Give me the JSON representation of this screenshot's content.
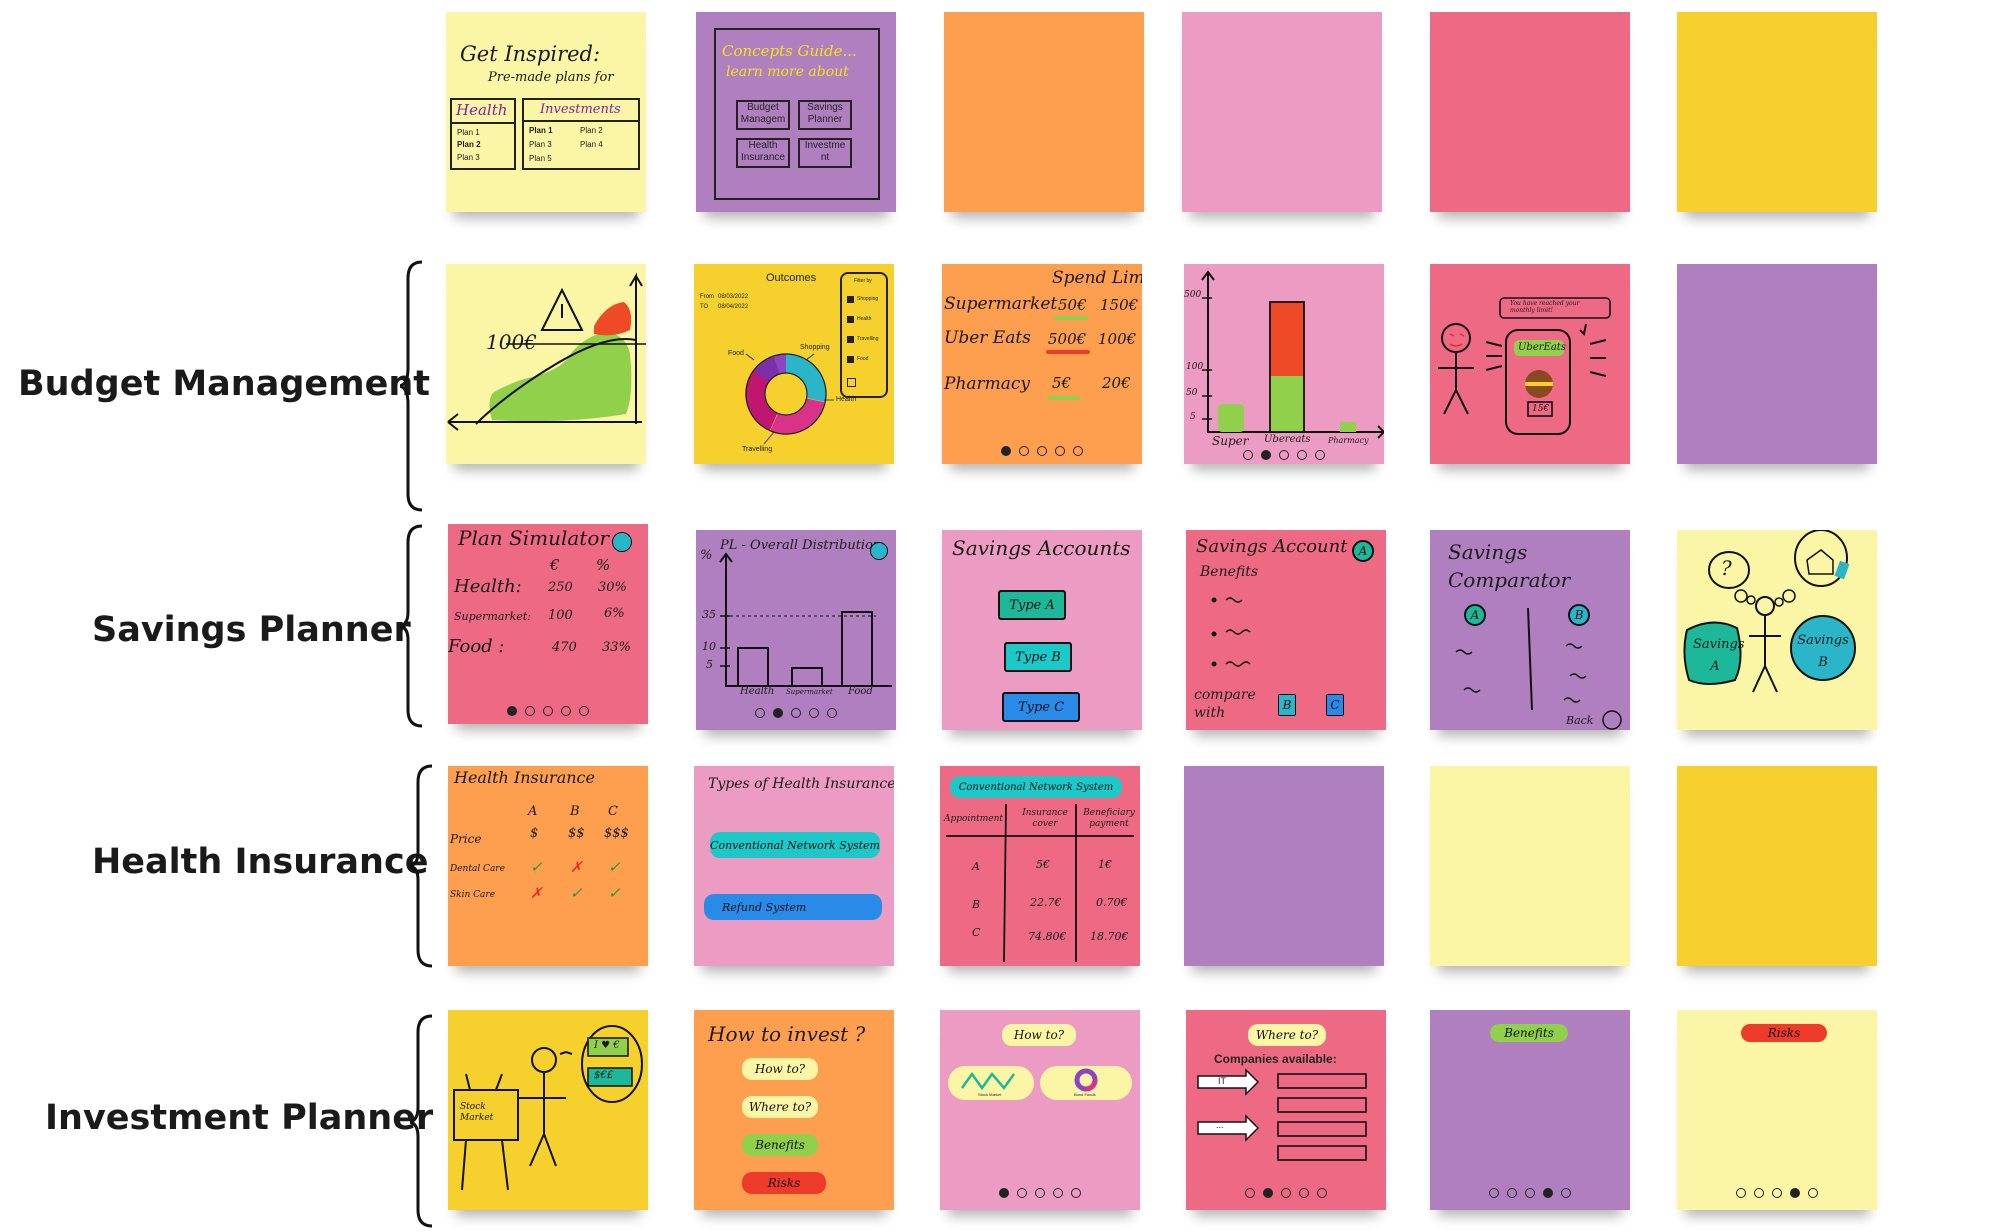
{
  "colors": {
    "yellow": "#fbf5a6",
    "gold": "#f6d02c",
    "purple": "#b07fc0",
    "orange": "#fd9f4e",
    "pink": "#ec9bc2",
    "coral": "#ee6a84"
  },
  "rows": [
    {
      "label": "Budget Management"
    },
    {
      "label": "Savings Planner"
    },
    {
      "label": "Health Insurance"
    },
    {
      "label": "Investment Planner"
    }
  ],
  "top": {
    "inspire": {
      "title": "Get Inspired:",
      "subtitle": "Pre-made plans for",
      "health": "Health",
      "investments": "Investments",
      "health_plans": [
        "Plan 1",
        "Plan 2",
        "Plan 3"
      ],
      "invest_plans_a": [
        "Plan 1",
        "Plan 3",
        "Plan 5"
      ],
      "invest_plans_b": [
        "Plan 2",
        "Plan 4"
      ]
    },
    "concepts": {
      "title": "Concepts Guide...",
      "subtitle": "learn more about",
      "buttons": [
        "Budget Managem",
        "Savings Planner",
        "Health Insurance",
        "Investme nt"
      ]
    }
  },
  "budget": {
    "limit": {
      "label": "100€"
    },
    "outcomes": {
      "title": "Outcomes",
      "from_label": "From",
      "from_date": "08/03/2022",
      "to_label": "TO",
      "to_date": "08/04/2022",
      "filter_title": "Filter by",
      "filters": [
        "Shopping",
        "Health",
        "Travelling",
        "Food",
        ""
      ],
      "slices": [
        "Food",
        "Shopping",
        "Health",
        "Travelling"
      ]
    },
    "spend": {
      "header": "Spend Limit",
      "rows": [
        {
          "name": "Supermarket",
          "spent": "50€",
          "limit": "150€"
        },
        {
          "name": "Uber Eats",
          "spent": "500€",
          "limit": "100€"
        },
        {
          "name": "Pharmacy",
          "spent": "5€",
          "limit": "20€"
        }
      ]
    },
    "bars": {
      "yticks": [
        "500",
        "100",
        "50",
        "5"
      ],
      "xlabels": [
        "Super",
        "Ubereats",
        "Pharmacy"
      ]
    },
    "alert": {
      "bubble": "You have reached your monthly limit!",
      "app": "UberEats",
      "price": "15€"
    }
  },
  "savings": {
    "simulator": {
      "title": "Plan Simulator",
      "cols": [
        "€",
        "%"
      ],
      "rows": [
        {
          "name": "Health:",
          "eur": "250",
          "pct": "30%"
        },
        {
          "name": "Supermarket:",
          "eur": "100",
          "pct": "6%"
        },
        {
          "name": "Food :",
          "eur": "470",
          "pct": "33%"
        }
      ]
    },
    "distribution": {
      "title": "PL - Overall Distribution",
      "yunit": "%",
      "yticks": [
        "35",
        "10",
        "5"
      ],
      "xlabels": [
        "Health",
        "Supermarket",
        "Food"
      ]
    },
    "accounts": {
      "title": "Savings Accounts",
      "types": [
        "Type A",
        "Type B",
        "Type C"
      ]
    },
    "accountA": {
      "title": "Savings Account",
      "badge": "A",
      "benefits": "Benefits",
      "compare": "compare with",
      "options": [
        "B",
        "C"
      ]
    },
    "comparator": {
      "title": "Savings Comparator",
      "a": "A",
      "b": "B",
      "back": "Back"
    },
    "bubbles": {
      "q": "?",
      "a": "Savings A",
      "b": "Savings B"
    }
  },
  "health": {
    "insurance": {
      "title": "Health Insurance",
      "cols": [
        "A",
        "B",
        "C"
      ],
      "rows": [
        {
          "name": "Price",
          "v": [
            "$",
            "$$",
            "$$$"
          ]
        },
        {
          "name": "Dental Care",
          "v": [
            "✓",
            "✗",
            "✓"
          ]
        },
        {
          "name": "Skin Care",
          "v": [
            "✗",
            "✓",
            "✓"
          ]
        }
      ]
    },
    "types": {
      "title": "Types of Health Insurance",
      "items": [
        "Conventional Network System",
        "Refund System"
      ]
    },
    "network": {
      "title": "Conventional Network System",
      "headers": [
        "Appointment",
        "Insurance cover",
        "Beneficiary payment"
      ],
      "rows": [
        [
          "A",
          "5€",
          "1€"
        ],
        [
          "B",
          "22.7€",
          "0.70€"
        ],
        [
          "C",
          "74.80€",
          "18.70€"
        ]
      ]
    }
  },
  "invest": {
    "stick": {
      "board": "Stock Market",
      "b1": "I ♥ €",
      "b2": "$€£"
    },
    "how": {
      "title": "How to invest ?",
      "pills": [
        "How to?",
        "Where to?",
        "Benefits",
        "Risks"
      ]
    },
    "howto": {
      "pill": "How to?",
      "cards": [
        "Stock Market",
        "Bond Funds"
      ]
    },
    "whereto": {
      "pill": "Where to?",
      "heading": "Companies available:",
      "arrows": [
        "IT",
        "..."
      ]
    },
    "benefits": {
      "pill": "Benefits"
    },
    "risks": {
      "pill": "Risks"
    }
  }
}
